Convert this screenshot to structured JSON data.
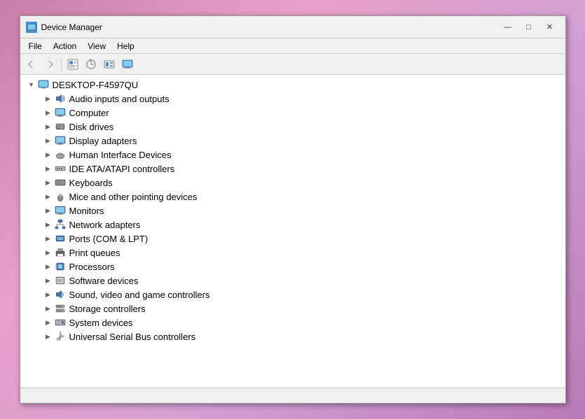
{
  "window": {
    "title": "Device Manager",
    "icon": "🖥"
  },
  "title_controls": {
    "minimize": "—",
    "maximize": "□",
    "close": "✕"
  },
  "menu": {
    "items": [
      "File",
      "Action",
      "View",
      "Help"
    ]
  },
  "toolbar": {
    "buttons": [
      "◀",
      "▶",
      "☰",
      "⚡",
      "☰",
      "🖥"
    ]
  },
  "tree": {
    "root": {
      "label": "DESKTOP-F4597QU",
      "icon": "🖥"
    },
    "items": [
      {
        "label": "Audio inputs and outputs",
        "icon": "🔊"
      },
      {
        "label": "Computer",
        "icon": "🖥"
      },
      {
        "label": "Disk drives",
        "icon": "💾"
      },
      {
        "label": "Display adapters",
        "icon": "🖥"
      },
      {
        "label": "Human Interface Devices",
        "icon": "🎮"
      },
      {
        "label": "IDE ATA/ATAPI controllers",
        "icon": "📋"
      },
      {
        "label": "Keyboards",
        "icon": "⌨"
      },
      {
        "label": "Mice and other pointing devices",
        "icon": "🖱"
      },
      {
        "label": "Monitors",
        "icon": "🖥"
      },
      {
        "label": "Network adapters",
        "icon": "🌐"
      },
      {
        "label": "Ports (COM & LPT)",
        "icon": "🔌"
      },
      {
        "label": "Print queues",
        "icon": "🖨"
      },
      {
        "label": "Processors",
        "icon": "⚙"
      },
      {
        "label": "Software devices",
        "icon": "📋"
      },
      {
        "label": "Sound, video and game controllers",
        "icon": "🔊"
      },
      {
        "label": "Storage controllers",
        "icon": "💾"
      },
      {
        "label": "System devices",
        "icon": "🔧"
      },
      {
        "label": "Universal Serial Bus controllers",
        "icon": "🔌"
      }
    ]
  }
}
